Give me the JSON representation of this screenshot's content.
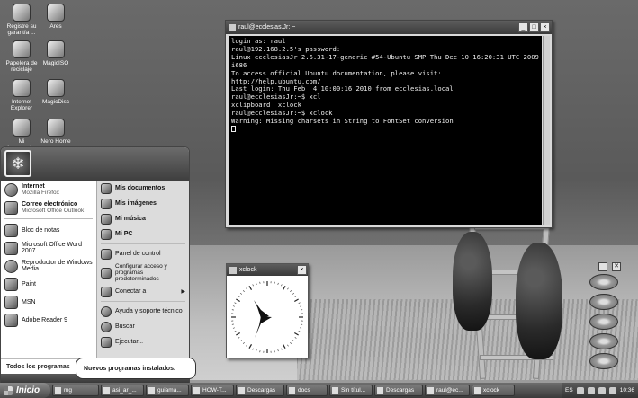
{
  "desktop": {
    "icons": [
      {
        "label": "Registre su garantía ..."
      },
      {
        "label": "Ares"
      },
      {
        "label": "Papelera de reciclaje"
      },
      {
        "label": "MagicISO"
      },
      {
        "label": "Internet Explorer"
      },
      {
        "label": "MagicDisc"
      },
      {
        "label": "Mi documentos"
      },
      {
        "label": "Nero Home"
      }
    ]
  },
  "terminal": {
    "title": "raul@ecclesias.Jr: ~",
    "lines": [
      "login as: raul",
      "raul@192.168.2.5's password:",
      "Linux ecclesiasJr 2.6.31-17-generic #54-Ubuntu SMP Thu Dec 10 16:20:31 UTC 2009",
      "i686",
      "",
      "To access official Ubuntu documentation, please visit:",
      "http://help.ubuntu.com/",
      "",
      "Last login: Thu Feb  4 10:00:16 2010 from ecclesias.local",
      "raul@ecclesiasJr:~$ xcl",
      "xclipboard  xclock",
      "raul@ecclesiasJr:~$ xclock",
      "Warning: Missing charsets in String to FontSet conversion"
    ]
  },
  "xclock": {
    "title": "xclock"
  },
  "start_menu": {
    "left_pinned": [
      {
        "title": "Internet",
        "subtitle": "Mozilla Firefox"
      },
      {
        "title": "Correo electrónico",
        "subtitle": "Microsoft Office Outlook"
      }
    ],
    "left_recent": [
      "Bloc de notas",
      "Microsoft Office Word 2007",
      "Reproductor de Windows Media",
      "Paint",
      "MSN",
      "Adobe Reader 9"
    ],
    "all_programs": "Todos los programas",
    "right_top": [
      "Mis documentos",
      "Mis imágenes",
      "Mi música",
      "Mi PC"
    ],
    "right_mid": [
      "Panel de control",
      "Configurar acceso y programas predeterminados",
      "Conectar a"
    ],
    "right_bottom": [
      "Ayuda y soporte técnico",
      "Buscar",
      "Ejecutar..."
    ],
    "tooltip": "Nuevos programas instalados."
  },
  "taskbar": {
    "start_label": "Inicio",
    "buttons": [
      "mg",
      "asi_ar_...",
      "guiama...",
      "HOW-T...",
      "Descargas",
      "docs",
      "Sin títul...",
      "Descargas",
      "raul@ec...",
      "xclock"
    ],
    "tray_lang": "ES",
    "clock": "10:36"
  },
  "mini_buttons": {
    "close_glyph": "✕"
  }
}
